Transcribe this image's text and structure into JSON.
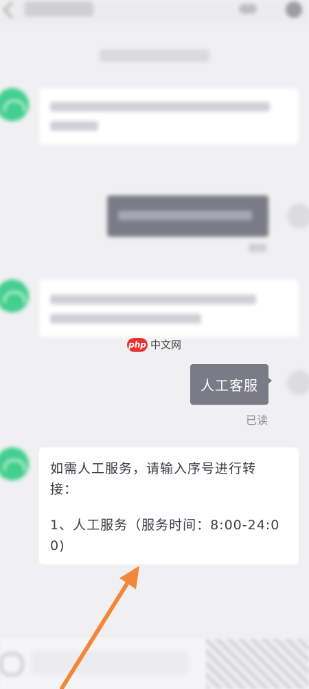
{
  "chat": {
    "messages": [
      {
        "from": "user",
        "text": "人工客服",
        "status": "已读"
      },
      {
        "from": "bot",
        "lines": [
          "如需人工服务，请输入序号进行转",
          "接："
        ],
        "option": [
          "1、人工服务（服务时间：8:00-24:0",
          "0)"
        ]
      }
    ]
  },
  "watermark": {
    "badge": "php",
    "text": "中文网"
  },
  "colors": {
    "bot_avatar": "#43cf8d",
    "user_bubble": "#7a7b87",
    "arrow": "#f2873a",
    "watermark_red": "#e9322e"
  },
  "icons": [
    "back-arrow-icon",
    "headset-icon",
    "menu-icon",
    "bot-avatar-icon",
    "user-avatar-icon",
    "voice-icon"
  ]
}
